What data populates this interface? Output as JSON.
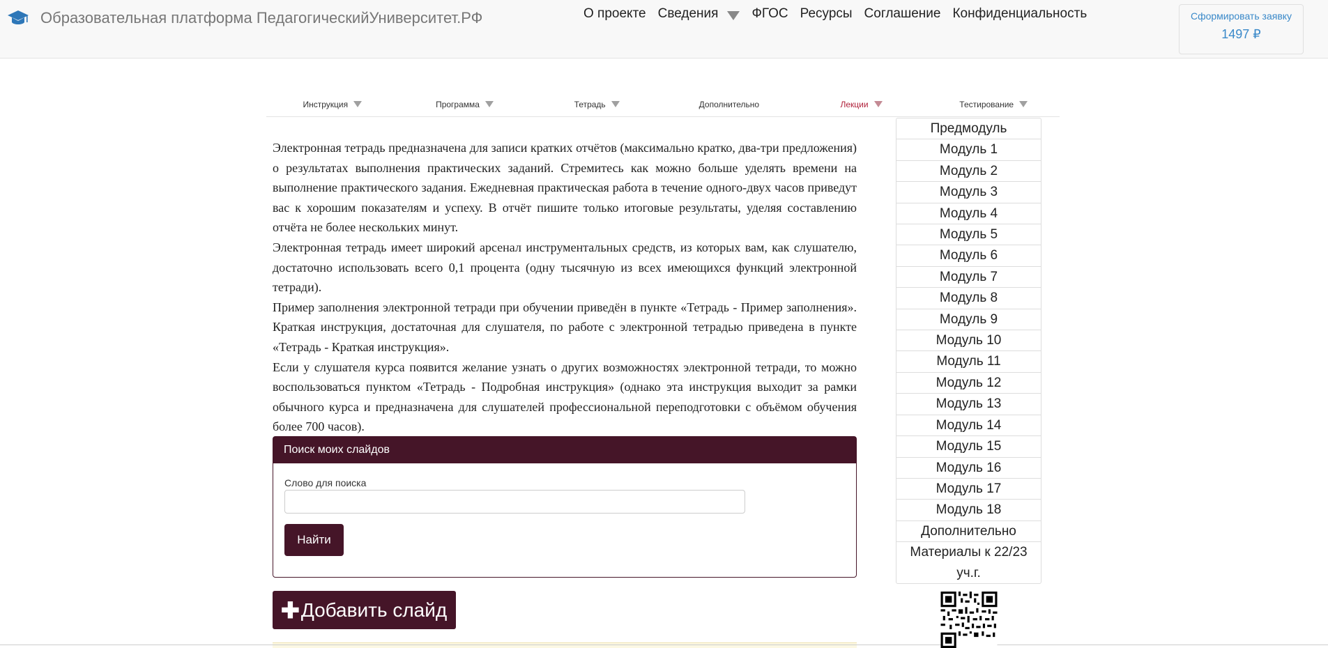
{
  "header": {
    "brand_title": "Образовательная платформа ПедагогическийУниверситет.РФ",
    "brand_icon": "graduation-cap-icon",
    "nav": [
      "О проекте",
      "Сведения",
      "ФГОС",
      "Ресурсы",
      "Соглашение",
      "Конфиденциальность"
    ],
    "order_label": "Сформировать заявку",
    "order_price": "1497 ₽"
  },
  "course_menu": [
    {
      "label": "Инструкция",
      "dropdown": true,
      "active": false
    },
    {
      "label": "Программа",
      "dropdown": true,
      "active": false
    },
    {
      "label": "Тетрадь",
      "dropdown": true,
      "active": false
    },
    {
      "label": "Дополнительно",
      "dropdown": false,
      "active": false
    },
    {
      "label": "Лекции",
      "dropdown": true,
      "active": true
    },
    {
      "label": "Тестирование",
      "dropdown": true,
      "active": false
    }
  ],
  "content": {
    "paragraphs": [
      "Электронная тетрадь предназначена для записи кратких отчётов (максимально кратко, два-три предложения) о результатах выполнения практических заданий. Стремитесь как можно больше уделять времени на выполнение практического задания. Ежедневная практическая работа в течение одного-двух часов приведут вас к хорошим показателям и успеху. В отчёт пишите только итоговые результаты, уделяя составлению отчёта не более нескольких минут.",
      "Электронная тетрадь имеет широкий арсенал инструментальных средств, из которых вам, как слушателю, достаточно использовать всего 0,1 процента (одну тысячную из всех имеющихся функций электронной тетради).",
      "Пример заполнения электронной тетради при обучении приведён в пункте «Тетрадь - Пример заполнения». Краткая инструкция, достаточная для слушателя, по работе с электронной тетрадью приведена в пункте «Тетрадь - Краткая инструкция».",
      "Если у слушателя курса появится желание узнать о других возможностях электронной тетради, то можно воспользоваться пунктом «Тетрадь - Подробная инструкция» (однако эта инструкция выходит за рамки обычного курса и предназначена для слушателей профессиональной переподготовки с объёмом обучения более 700 часов)."
    ]
  },
  "search_panel": {
    "title": "Поиск моих слайдов",
    "field_label": "Слово для поиска",
    "field_value": "",
    "button_label": "Найти"
  },
  "add_slide": {
    "label": "Добавить слайд",
    "icon": "plus-icon"
  },
  "modules": [
    "Предмодуль",
    "Модуль 1",
    "Модуль 2",
    "Модуль 3",
    "Модуль 4",
    "Модуль 5",
    "Модуль 6",
    "Модуль 7",
    "Модуль 8",
    "Модуль 9",
    "Модуль 10",
    "Модуль 11",
    "Модуль 12",
    "Модуль 13",
    "Модуль 14",
    "Модуль 15",
    "Модуль 16",
    "Модуль 17",
    "Модуль 18",
    "Дополнительно",
    "Материалы к 22/23 уч.г."
  ],
  "colors": {
    "accent": "#451528",
    "link": "#3a89c9",
    "active_menu": "#b0203a"
  }
}
